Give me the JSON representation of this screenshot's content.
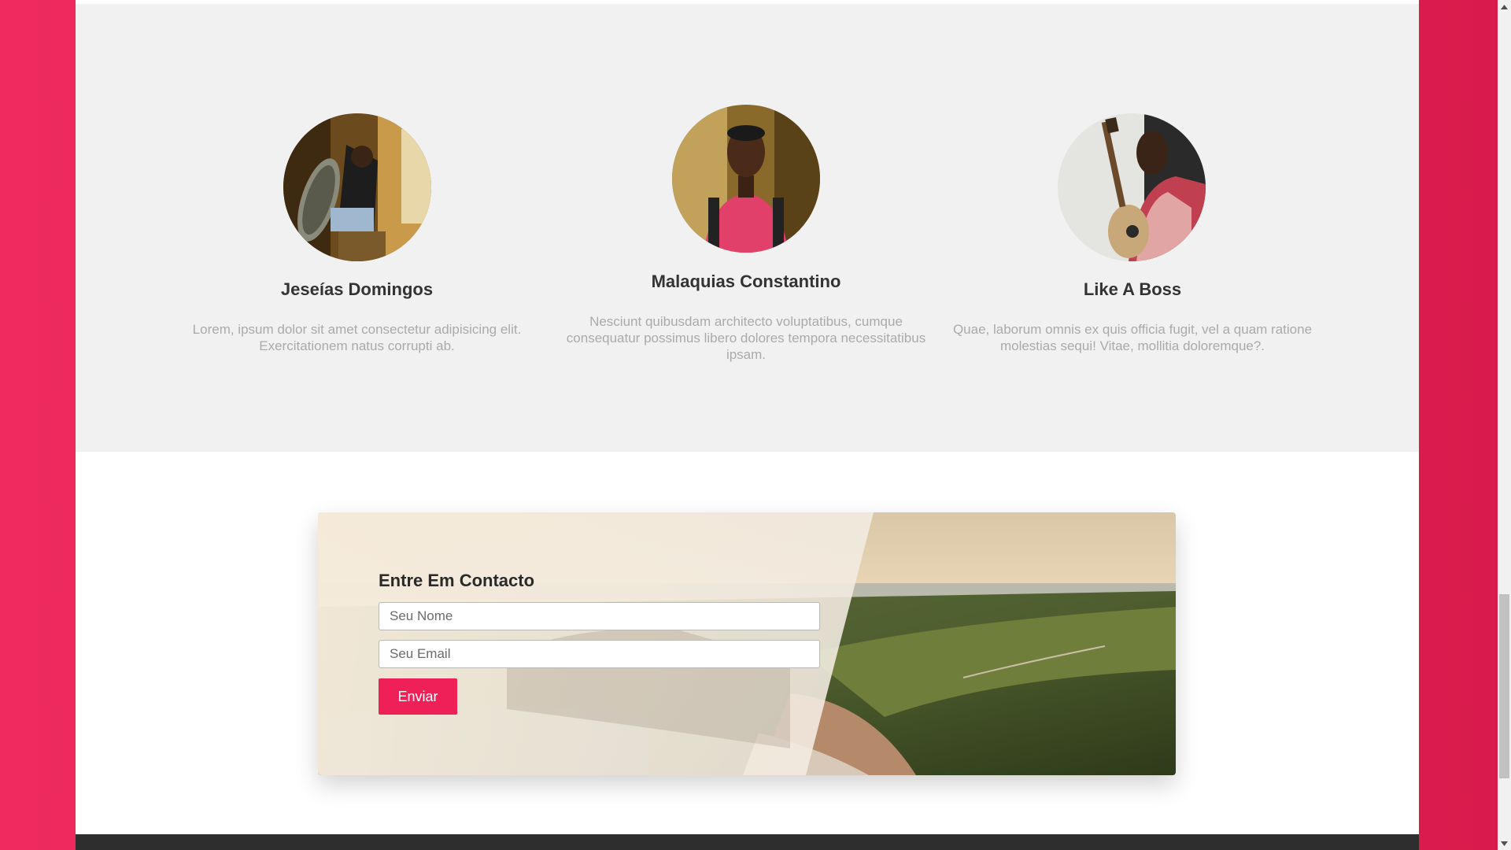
{
  "team": {
    "members": [
      {
        "name": "Jeseías Domingos",
        "description": "Lorem, ipsum dolor sit amet consectetur adipisicing elit. Exercitationem natus corrupti ab."
      },
      {
        "name": "Malaquias Constantino",
        "description": "Nesciunt quibusdam architecto voluptatibus, cumque consequatur possimus libero dolores tempora necessitatibus ipsam."
      },
      {
        "name": "Like A Boss",
        "description": "Quae, laborum omnis ex quis officia fugit, vel a quam ratione molestias sequi! Vitae, mollitia doloremque?."
      }
    ]
  },
  "contact": {
    "title": "Entre Em Contacto",
    "name_placeholder": "Seu Nome",
    "email_placeholder": "Seu Email",
    "submit_label": "Enviar"
  },
  "colors": {
    "accent": "#ef2058",
    "side_background": "#e22254",
    "team_background": "#f1f1f1",
    "footer": "#2e2e2e"
  },
  "icons": {
    "scroll_up": "chevron-up-icon",
    "scroll_down": "chevron-down-icon"
  }
}
